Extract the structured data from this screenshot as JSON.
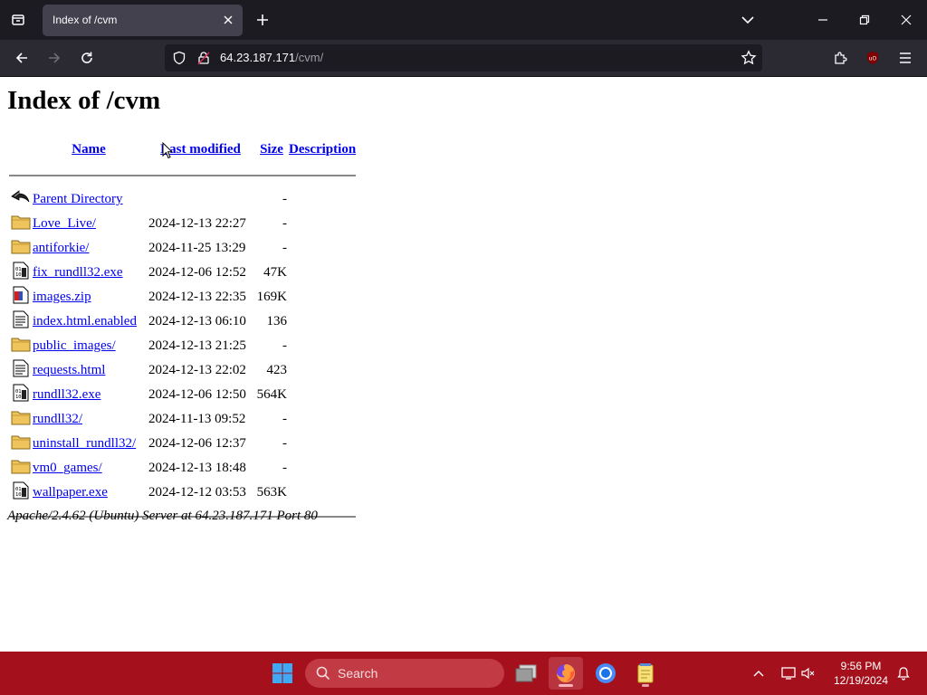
{
  "browser": {
    "tab_title": "Index of /cvm",
    "url_host": "64.23.187.171",
    "url_path": "/cvm/"
  },
  "page": {
    "title": "Index of /cvm",
    "columns": {
      "name": "Name",
      "last_modified": "Last modified",
      "size": "Size",
      "description": "Description"
    },
    "parent": {
      "name": "Parent Directory",
      "size": "-"
    },
    "rows": [
      {
        "icon": "folder-icon",
        "name": "Love_Live/",
        "date": "2024-12-13 22:27",
        "size": "-"
      },
      {
        "icon": "folder-icon",
        "name": "antiforkie/",
        "date": "2024-11-25 13:29",
        "size": "-"
      },
      {
        "icon": "binary-icon",
        "name": "fix_rundll32.exe",
        "date": "2024-12-06 12:52",
        "size": "47K"
      },
      {
        "icon": "archive-icon",
        "name": "images.zip",
        "date": "2024-12-13 22:35",
        "size": "169K"
      },
      {
        "icon": "text-icon",
        "name": "index.html.enabled",
        "date": "2024-12-13 06:10",
        "size": "136"
      },
      {
        "icon": "folder-icon",
        "name": "public_images/",
        "date": "2024-12-13 21:25",
        "size": "-"
      },
      {
        "icon": "text-icon",
        "name": "requests.html",
        "date": "2024-12-13 22:02",
        "size": "423"
      },
      {
        "icon": "binary-icon",
        "name": "rundll32.exe",
        "date": "2024-12-06 12:50",
        "size": "564K"
      },
      {
        "icon": "folder-icon",
        "name": "rundll32/",
        "date": "2024-11-13 09:52",
        "size": "-"
      },
      {
        "icon": "folder-icon",
        "name": "uninstall_rundll32/",
        "date": "2024-12-06 12:37",
        "size": "-"
      },
      {
        "icon": "folder-icon",
        "name": "vm0_games/",
        "date": "2024-12-13 18:48",
        "size": "-"
      },
      {
        "icon": "binary-icon",
        "name": "wallpaper.exe",
        "date": "2024-12-12 03:53",
        "size": "563K"
      }
    ],
    "footer": "Apache/2.4.62 (Ubuntu) Server at 64.23.187.171 Port 80"
  },
  "taskbar": {
    "search_label": "Search",
    "time": "9:56 PM",
    "date": "12/19/2024",
    "accent": "#a4101b"
  }
}
